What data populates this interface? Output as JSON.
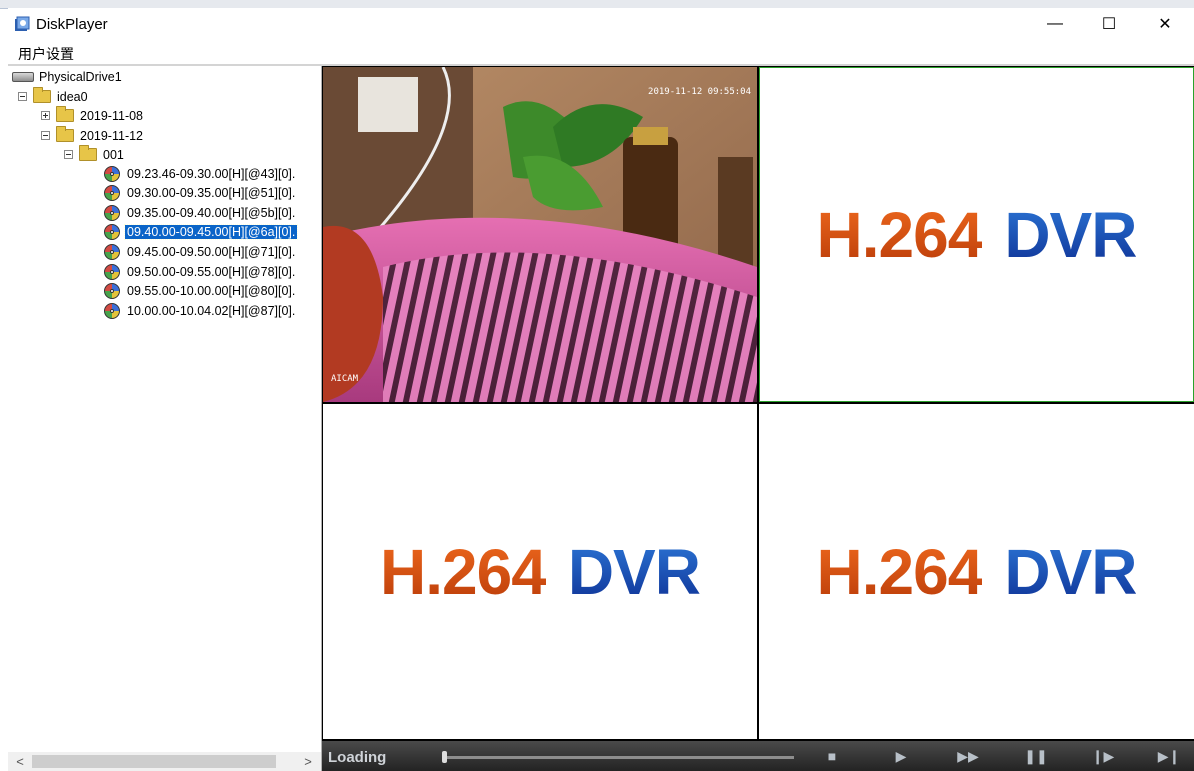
{
  "window": {
    "title": "DiskPlayer",
    "minimize_glyph": "—",
    "maximize_glyph": "☐",
    "close_glyph": "✕"
  },
  "menu": {
    "user_settings": "用户设置"
  },
  "tree": {
    "drive": "PhysicalDrive1",
    "disk": "idea0",
    "date_collapsed": "2019-11-08",
    "date_expanded": "2019-11-12",
    "channel": "001",
    "files": [
      "09.23.46-09.30.00[H][@43][0].",
      "09.30.00-09.35.00[H][@51][0].",
      "09.35.00-09.40.00[H][@5b][0].",
      "09.40.00-09.45.00[H][@6a][0].",
      "09.45.00-09.50.00[H][@71][0].",
      "09.50.00-09.55.00[H][@78][0].",
      "09.55.00-10.00.00[H][@80][0].",
      "10.00.00-10.04.02[H][@87][0]."
    ],
    "selected_index": 3
  },
  "scrollbar": {
    "left_arrow": "<",
    "right_arrow": ">"
  },
  "video": {
    "camera_timestamp": "2019-11-12 09:55:04",
    "camera_name": "AICAM",
    "brand_left": "H.264",
    "brand_right": "DVR",
    "channels": 4,
    "active_channel": 2
  },
  "playbar": {
    "status": "Loading",
    "progress": 0.0,
    "buttons": {
      "stop": "■",
      "play": "▶",
      "fast_forward": "▶▶",
      "pause": "❚❚",
      "step_forward": "❙▶",
      "step_end": "▶❙"
    }
  },
  "colors": {
    "selection": "#0a64c8",
    "active_border": "#2aa22a",
    "brand_orange": "#e85e1a",
    "brand_blue": "#1a4fb8"
  }
}
